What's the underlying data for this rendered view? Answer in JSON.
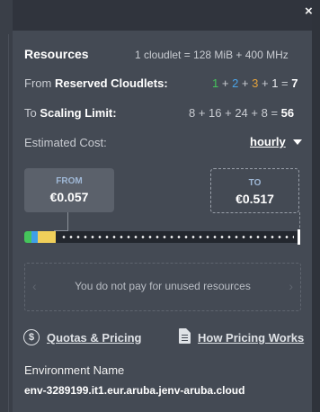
{
  "window": {
    "close_glyph": "×"
  },
  "resources": {
    "title": "Resources",
    "cloudlet_info": "1 cloudlet = 128 MiB + 400 MHz"
  },
  "reserved": {
    "prefix": "From",
    "label": "Reserved Cloudlets:",
    "values": [
      "1",
      "2",
      "3",
      "1"
    ],
    "value_colors": [
      "#45c55b",
      "#4aa3e8",
      "#e6a23a",
      "#e8eaee"
    ],
    "total": "7"
  },
  "scaling": {
    "prefix": "To",
    "label": "Scaling Limit:",
    "expression": "8 + 16 + 24 + 8 =",
    "total": "56"
  },
  "cost": {
    "label": "Estimated Cost:",
    "period": "hourly",
    "period_icon": "caret-down-icon",
    "from_label": "FROM",
    "from_value": "€0.057",
    "to_label": "TO",
    "to_value": "€0.517"
  },
  "slider": {
    "segment_colors": [
      "#45c55b",
      "#3f9fe6",
      "#f0cf5a"
    ]
  },
  "notice": {
    "text": "You do not pay for unused resources",
    "left_arrow": "‹",
    "right_arrow": "›"
  },
  "links": {
    "quotas": "Quotas & Pricing",
    "quotas_icon": "dollar-circle-icon",
    "how_pricing": "How Pricing Works",
    "how_pricing_icon": "document-icon"
  },
  "environment": {
    "label": "Environment Name",
    "name": "env-3289199.it1.eur.aruba.jenv-aruba.cloud"
  }
}
